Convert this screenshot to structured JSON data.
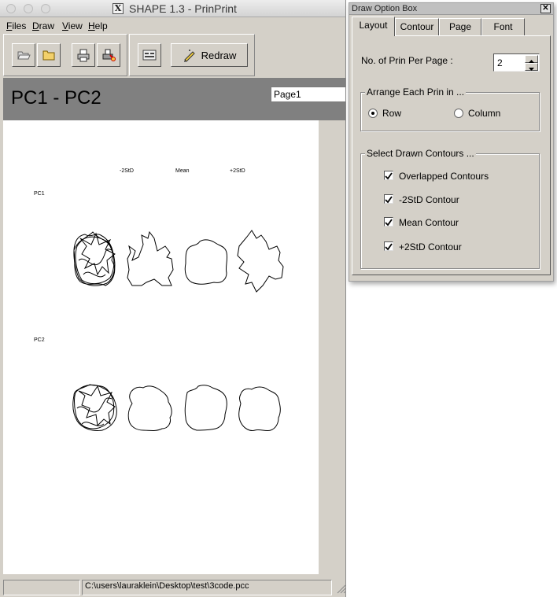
{
  "window": {
    "title": "SHAPE 1.3 - PrinPrint",
    "x_glyph": "X"
  },
  "menu": {
    "items": [
      {
        "accel": "F",
        "rest": "iles"
      },
      {
        "accel": "D",
        "rest": "raw"
      },
      {
        "accel": "V",
        "rest": "iew"
      },
      {
        "accel": "H",
        "rest": "elp"
      }
    ]
  },
  "toolbar": {
    "redraw_label": "Redraw",
    "buttons": [
      "open-file",
      "open-folder",
      "print",
      "print-setup",
      "page-settings"
    ]
  },
  "header": {
    "title": "PC1 - PC2",
    "page_select": "Page1"
  },
  "print_page": {
    "column_labels": [
      "-2StD",
      "Mean",
      "+2StD"
    ],
    "row_labels": [
      "PC1",
      "PC2"
    ]
  },
  "status": {
    "path": "C:\\users\\lauraklein\\Desktop\\test\\3code.pcc"
  },
  "option_box": {
    "title": "Draw Option Box",
    "close_glyph": "✕",
    "tabs": [
      "Layout",
      "Contour",
      "Page",
      "Font"
    ],
    "active_tab": "Layout",
    "prin_per_page_label": "No. of Prin Per Page :",
    "prin_per_page_value": "2",
    "arrange_group_label": "Arrange Each Prin in ...",
    "arrange_options": [
      {
        "label": "Row",
        "selected": true
      },
      {
        "label": "Column",
        "selected": false
      }
    ],
    "contours_group_label": "Select Drawn Contours ...",
    "contour_options": [
      {
        "label": "Overlapped Contours",
        "checked": true
      },
      {
        "label": "-2StD Contour",
        "checked": true
      },
      {
        "label": "Mean Contour",
        "checked": true
      },
      {
        "label": "+2StD Contour",
        "checked": true
      }
    ]
  },
  "colors": {
    "window_bg": "#d4d0c8",
    "header_band": "#808080",
    "page_bg": "#ffffff"
  }
}
